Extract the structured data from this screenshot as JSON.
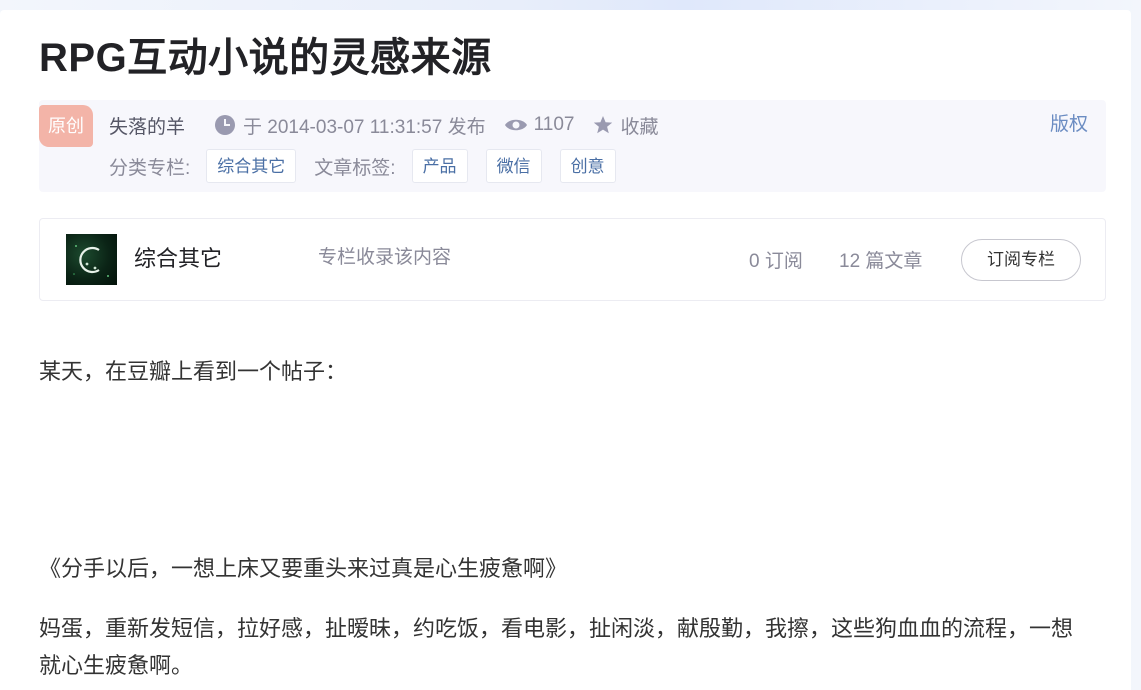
{
  "article": {
    "title": "RPG互动小说的灵感来源",
    "original_badge": "原创",
    "author": "失落的羊",
    "publish_text": "于 2014-03-07 11:31:57 发布",
    "view_count": "1107",
    "favorite_label": "收藏",
    "copyright_label": "版权",
    "category_label": "分类专栏:",
    "categories": [
      "综合其它"
    ],
    "tags_label": "文章标签:",
    "tags": [
      "产品",
      "微信",
      "创意"
    ]
  },
  "column": {
    "name": "综合其它",
    "description": "专栏收录该内容",
    "subscribers": "0 订阅",
    "articles": "12 篇文章",
    "subscribe_label": "订阅专栏"
  },
  "content": {
    "paragraphs": [
      "某天，在豆瓣上看到一个帖子：",
      "《分手以后，一想上床又要重头来过真是心生疲惫啊》",
      "妈蛋，重新发短信，拉好感，扯暧昧，约吃饭，看电影，扯闲淡，献殷勤，我擦，这些狗血血的流程，一想就心生疲惫啊。"
    ]
  },
  "icons": {
    "clock": "clock-icon",
    "views": "eye-icon",
    "favorite": "star-icon"
  },
  "colors": {
    "original_badge": "#f3b4a8",
    "tag_text": "#4a6fa5",
    "meta_background": "#f7f7fc"
  }
}
